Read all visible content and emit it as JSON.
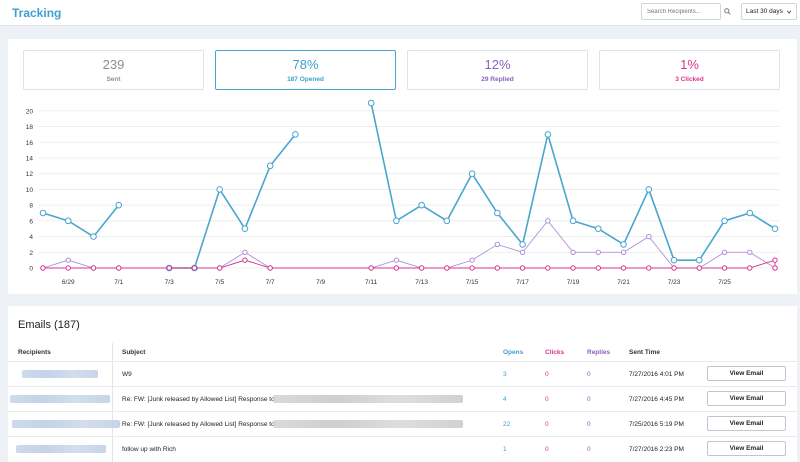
{
  "header": {
    "title": "Tracking",
    "search_placeholder": "Search Recipients...",
    "date_range": "Last 30 days"
  },
  "stats": [
    {
      "value": "239",
      "label": "Sent",
      "color": "#8a8f95"
    },
    {
      "value": "78%",
      "label": "187 Opened",
      "color": "#3f9fd0"
    },
    {
      "value": "12%",
      "label": "29 Replied",
      "color": "#8a5fc0"
    },
    {
      "value": "1%",
      "label": "3 Clicked",
      "color": "#d7358c"
    }
  ],
  "chart_data": {
    "type": "line",
    "x_tick_labels": [
      "6/29",
      "7/1",
      "7/3",
      "7/5",
      "7/7",
      "7/9",
      "7/11",
      "7/13",
      "7/15",
      "7/17",
      "7/19",
      "7/21",
      "7/23",
      "7/25"
    ],
    "ylim": [
      0,
      21
    ],
    "y_ticks": [
      0,
      2,
      4,
      6,
      8,
      10,
      12,
      14,
      16,
      18,
      20
    ],
    "grid": true,
    "series": [
      {
        "color": "#4aa5cf",
        "values": [
          7,
          6,
          4,
          8,
          null,
          0,
          0,
          10,
          5,
          13,
          17,
          null,
          21,
          6,
          8,
          6,
          12,
          7,
          3,
          17,
          6,
          5,
          3,
          10,
          1,
          1,
          6,
          7,
          5
        ],
        "x": [
          0,
          1,
          2,
          3,
          null,
          5,
          6,
          7,
          8,
          9,
          10,
          null,
          13,
          14,
          15,
          16,
          17,
          18,
          19,
          20,
          21,
          22,
          23,
          24,
          25,
          26,
          27,
          28,
          29
        ]
      },
      {
        "color": "#b18fd8",
        "values": [
          0,
          1,
          0,
          0,
          0,
          0,
          0,
          2,
          0,
          0,
          1,
          0,
          0,
          1,
          3,
          2,
          6,
          2,
          2,
          2,
          4,
          0,
          0,
          2,
          2,
          0
        ],
        "x": [
          0,
          1,
          2,
          3,
          5,
          6,
          7,
          8,
          9,
          13,
          14,
          15,
          16,
          17,
          18,
          19,
          20,
          21,
          22,
          23,
          24,
          25,
          26,
          27,
          28,
          29
        ]
      },
      {
        "color": "#d7358c",
        "values": [
          0,
          0,
          0,
          0,
          0,
          0,
          0,
          1,
          0,
          0,
          0,
          0,
          0,
          0,
          0,
          0,
          0,
          0,
          0,
          0,
          0,
          0,
          0,
          0,
          0,
          1,
          0
        ],
        "x": [
          0,
          1,
          2,
          3,
          5,
          6,
          7,
          8,
          9,
          13,
          14,
          15,
          16,
          17,
          18,
          19,
          20,
          21,
          22,
          23,
          24,
          25,
          26,
          27,
          28,
          29,
          29
        ]
      }
    ]
  },
  "emails": {
    "title": "Emails (187)",
    "columns": {
      "recipients": "Recipients",
      "subject": "Subject",
      "opens": "Opens",
      "clicks": "Clicks",
      "replies": "Replies",
      "sent_time": "Sent Time"
    },
    "view_label": "View Email",
    "rows": [
      {
        "subject": "W9",
        "opens": "3",
        "clicks": "0",
        "replies": "0",
        "sent": "7/27/2016 4:01 PM"
      },
      {
        "subject": "Re: FW: [Junk released by Allowed List] Response to:",
        "opens": "4",
        "clicks": "0",
        "replies": "0",
        "sent": "7/27/2016 4:45 PM"
      },
      {
        "subject": "Re: FW: [Junk released by Allowed List] Response to:",
        "opens": "22",
        "clicks": "0",
        "replies": "0",
        "sent": "7/25/2016 5:19 PM"
      },
      {
        "subject": "follow up with Rich",
        "opens": "1",
        "clicks": "0",
        "replies": "0",
        "sent": "7/27/2016 2:23 PM"
      }
    ]
  }
}
